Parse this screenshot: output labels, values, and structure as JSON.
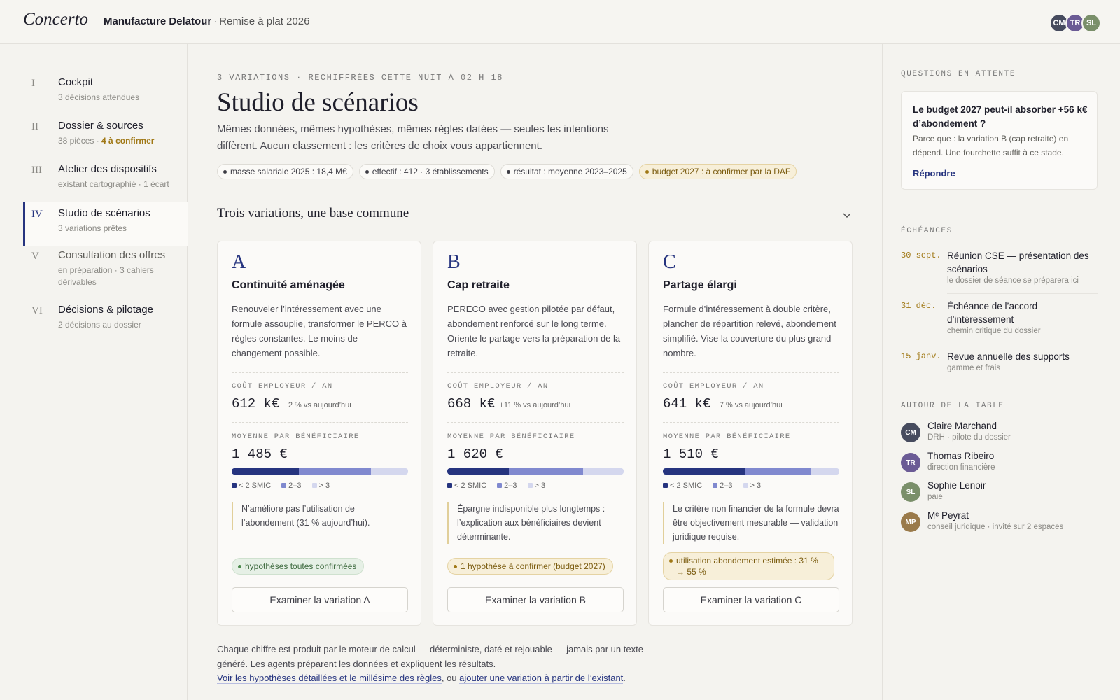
{
  "app": {
    "logo": "Concerto",
    "project_name": "Manufacture Delatour",
    "project_sep": "·",
    "project_period": "Remise à plat 2026",
    "avatars": [
      {
        "initials": "CM",
        "color": "#464b5e"
      },
      {
        "initials": "TR",
        "color": "#6b5b95"
      },
      {
        "initials": "SL",
        "color": "#7a8f6a"
      }
    ]
  },
  "sidebar": {
    "items": [
      {
        "num": "I",
        "title": "Cockpit",
        "sub": "3 décisions attendues",
        "sub_warn": ""
      },
      {
        "num": "II",
        "title": "Dossier & sources",
        "sub": "38 pièces ·",
        "sub_warn": "4 à confirmer"
      },
      {
        "num": "III",
        "title": "Atelier des dispositifs",
        "sub": "existant cartographié · 1 écart",
        "sub_warn": ""
      },
      {
        "num": "IV",
        "title": "Studio de scénarios",
        "sub": "3 variations prêtes",
        "sub_warn": ""
      },
      {
        "num": "V",
        "title": "Consultation des offres",
        "sub": "en préparation · 3 cahiers dérivables",
        "sub_warn": ""
      },
      {
        "num": "VI",
        "title": "Décisions & pilotage",
        "sub": "2 décisions au dossier",
        "sub_warn": ""
      }
    ]
  },
  "main": {
    "kicker": "3 VARIATIONS · RECHIFFRÉES CETTE NUIT À 02 H 18",
    "title": "Studio de scénarios",
    "lead": "Mêmes données, mêmes hypothèses, mêmes règles datées — seules les intentions diffèrent. Aucun classement : les critères de choix vous appartiennent.",
    "chips": [
      "masse salariale 2025 : 18,4 M€",
      "effectif : 412 · 3 établissements",
      "résultat : moyenne 2023–2025",
      "budget 2027 : à confirmer par la DAF"
    ],
    "section_title": "Trois variations, une base commune",
    "cost_label": "COÛT EMPLOYEUR / AN",
    "avg_label": "MOYENNE PAR BÉNÉFICIAIRE",
    "legend": [
      "< 2 SMIC",
      "2–3",
      "> 3"
    ],
    "colors": {
      "seg1": "#26347f",
      "seg2": "#8089cf",
      "seg3": "#d4d7ee"
    },
    "cards": [
      {
        "letter": "A",
        "title": "Continuité aménagée",
        "desc": "Renouveler l’intéressement avec une formule assouplie, transformer le PERCO à règles constantes. Le moins de changement possible.",
        "cost": "612 k€",
        "delta": "+2 % vs aujourd’hui",
        "avg": "1 485 €",
        "distribution": [
          0.38,
          0.41,
          0.21
        ],
        "note": "N’améliore pas l’utilisation de l’abondement (31 % aujourd’hui).",
        "status": "hypothèses toutes confirmées",
        "status_kind": "ok",
        "button": "Examiner la variation A"
      },
      {
        "letter": "B",
        "title": "Cap retraite",
        "desc": "PERECO avec gestion pilotée par défaut, abondement renforcé sur le long terme. Oriente le partage vers la préparation de la retraite.",
        "cost": "668 k€",
        "delta": "+11 % vs aujourd’hui",
        "avg": "1 620 €",
        "distribution": [
          0.35,
          0.42,
          0.23
        ],
        "note": "Épargne indisponible plus longtemps : l’explication aux bénéficiaires devient déterminante.",
        "status": "1 hypothèse à confirmer (budget 2027)",
        "status_kind": "warn",
        "button": "Examiner la variation B"
      },
      {
        "letter": "C",
        "title": "Partage élargi",
        "desc": "Formule d’intéressement à double critère, plancher de répartition relevé, abondement simplifié. Vise la couverture du plus grand nombre.",
        "cost": "641 k€",
        "delta": "+7 % vs aujourd’hui",
        "avg": "1 510 €",
        "distribution": [
          0.47,
          0.37,
          0.16
        ],
        "note": "Le critère non financier de la formule devra être objectivement mesurable — validation juridique requise.",
        "status": "utilisation abondement estimée : 31 % → 55 %",
        "status_kind": "warn",
        "button": "Examiner la variation C"
      }
    ],
    "footnote": {
      "text": "Chaque chiffre est produit par le moteur de calcul — déterministe, daté et rejouable — jamais par un texte généré. Les agents préparent les données et expliquent les résultats.",
      "link1": "Voir les hypothèses détaillées et le millésime des règles",
      "mid": ", ou",
      "link2": "ajouter une variation à partir de l’existant",
      "end": "."
    }
  },
  "right": {
    "questions_label": "QUESTIONS EN ATTENTE",
    "question": {
      "title": "Le budget 2027 peut-il absorber +56 k€ d’abondement ?",
      "text": "Parce que : la variation B (cap retraite) en dépend. Une fourchette suffit à ce stade.",
      "link": "Répondre"
    },
    "deadlines_label": "ÉCHÉANCES",
    "deadlines": [
      {
        "date": "30 sept.",
        "title": "Réunion CSE — présentation des scénarios",
        "sub": "le dossier de séance se préparera ici"
      },
      {
        "date": "31 déc.",
        "title": "Échéance de l’accord d’intéressement",
        "sub": "chemin critique du dossier"
      },
      {
        "date": "15 janv.",
        "title": "Revue annuelle des supports",
        "sub": "gamme et frais"
      }
    ],
    "people_label": "AUTOUR DE LA TABLE",
    "people": [
      {
        "initials": "CM",
        "name": "Claire Marchand",
        "role": "DRH · pilote du dossier",
        "color": "#464b5e"
      },
      {
        "initials": "TR",
        "name": "Thomas Ribeiro",
        "role": "direction financière",
        "color": "#6b5b95"
      },
      {
        "initials": "SL",
        "name": "Sophie Lenoir",
        "role": "paie",
        "color": "#7a8f6a"
      },
      {
        "initials": "MP",
        "name": "Mᵉ Peyrat",
        "role": "conseil juridique · invité sur 2 espaces",
        "color": "#9a7a4a"
      }
    ]
  }
}
